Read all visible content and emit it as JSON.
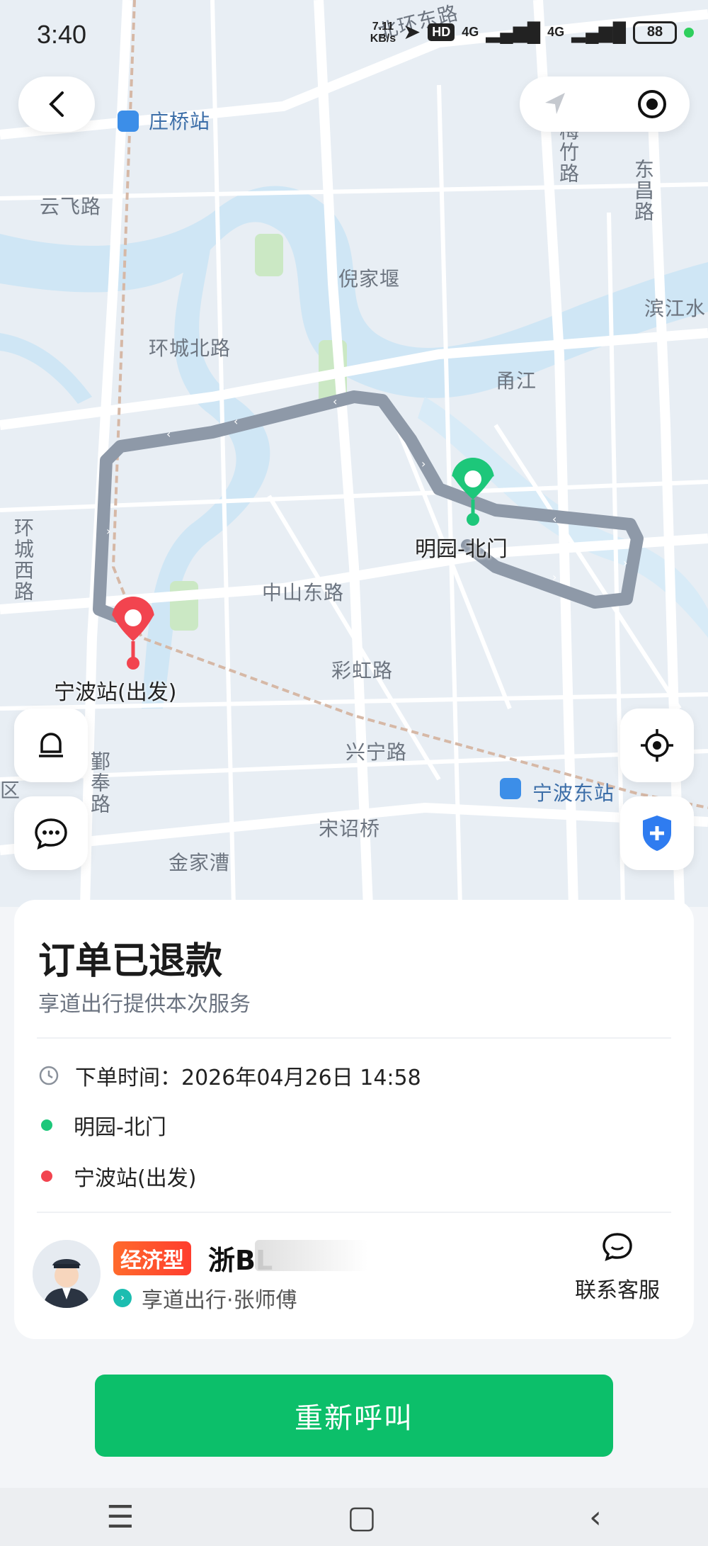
{
  "status_bar": {
    "time": "3:40",
    "net_speed_value": "7.11",
    "net_speed_unit": "KB/s",
    "hd_badge": "HD",
    "signal_1": "4G",
    "signal_2": "4G",
    "battery": "88"
  },
  "map": {
    "labels": {
      "zhuangqiao_station": "庄桥站",
      "yunfei_road": "云飞路",
      "nijiayan": "倪家堰",
      "huancheng_north_road": "环城北路",
      "huancheng_west_road": "环城西路",
      "yongjiang": "甬江",
      "binjiang": "滨江水",
      "zhongshan_east_road": "中山东路",
      "caihong_road": "彩虹路",
      "xingning_road": "兴宁路",
      "ningbo_east_station": "宁波东站",
      "songzhao_bridge": "宋诏桥",
      "jinjiacao": "金家漕",
      "meizhu_road": "梅竹路",
      "dongchang_road": "东昌路",
      "beihuan_east_road": "北环东路",
      "yinfeng_road": "鄞奉路",
      "district": "区"
    },
    "pickup_label": "明园-北门",
    "dropoff_label": "宁波站(出发)"
  },
  "order": {
    "title": "订单已退款",
    "subtitle": "享道出行提供本次服务",
    "order_time_label": "下单时间：",
    "order_time_value": "2026年04月26日 14:58",
    "pickup": "明园-北门",
    "dropoff": "宁波站(出发)"
  },
  "driver": {
    "car_type": "经济型",
    "plate": "浙BL",
    "provider": "享道出行·张师傅",
    "contact_label": "联系客服"
  },
  "actions": {
    "recall_label": "重新呼叫"
  },
  "nav_bar": {
    "menu": "☰",
    "home": "▢",
    "back": "‹"
  },
  "colors": {
    "primary_green": "#0cbf6a",
    "pickup_green": "#1dc77a",
    "dropoff_red": "#f2444f",
    "route_gray": "#8e99a8"
  }
}
